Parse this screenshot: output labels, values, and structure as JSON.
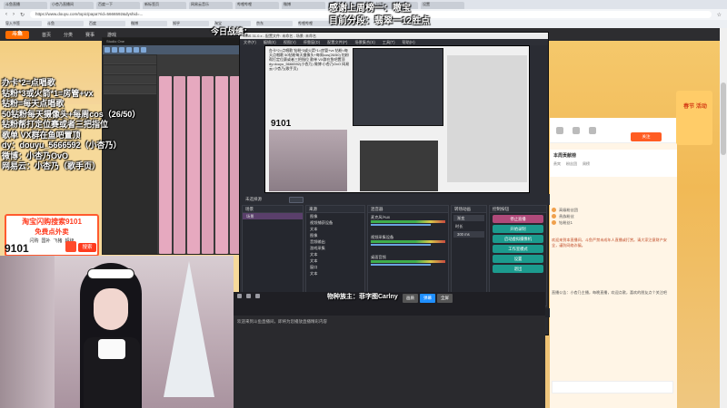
{
  "overlay": {
    "top_line1": "感谢上周榜一：嗷宝",
    "top_line2": "目前分段：翡翠一12胜点",
    "today_record": "今日战绩：",
    "lines": [
      "办卡*2=点唱歌",
      "钻粉*3或火箭*1=房管+vx",
      "钻粉=每天点唱歌",
      "50钻粉每天摄像头+每周cos（26/50）",
      "钻粉帮打定位赛或者三把指位",
      "歌单 VX群在鱼吧置顶",
      "dy：douyu_5666592（小杏乃）",
      "微博：小杏乃OvO",
      "网易云：小杏乃（歌手页）"
    ]
  },
  "promo": {
    "line1": "淘宝闪购搜索9101",
    "line2": "免费点外卖",
    "tags": [
      "闪购",
      "国补",
      "飞猪",
      "超级"
    ],
    "number": "9101",
    "search_label": "搜索"
  },
  "obs": {
    "menu": [
      "文件(F)",
      "编辑(E)",
      "视图(V)",
      "停靠窗(D)",
      "配置文件(P)",
      "场景集合(S)",
      "工具(T)",
      "帮助(H)"
    ],
    "preview_number": "9101",
    "preview_text": "办卡*2=点唱歌 钻粉*3或火箭*1=房管+vx 钻粉=每天点唱歌 50钻粉每天摄像头+每周cos(26/50) 钻粉帮打定位赛或者三把指位 歌单 VX群在鱼吧置顶 dy:douyu_5666592(小杏乃) 微博:小杏乃OvO 网易云:小杏乃(歌手页)",
    "no_source": "未选择源",
    "scenes_title": "场景",
    "scenes": [
      "场景"
    ],
    "sources_title": "来源",
    "sources": [
      "图像",
      "视频捕获设备",
      "文本",
      "图像",
      "音频输出",
      "游戏采集",
      "文本",
      "文本",
      "窗口",
      "文本"
    ],
    "mixer_title": "混音器",
    "mixer": [
      {
        "name": "麦克风/Aux",
        "db": "0.0 dB"
      },
      {
        "name": "视频采集设备",
        "db": "0.0 dB"
      },
      {
        "name": "桌面音频",
        "db": "0.0 dB"
      }
    ],
    "transitions_title": "转场动画",
    "transition_value": "渐变",
    "duration_label": "时长",
    "duration_value": "300 ms",
    "controls_title": "控制按钮",
    "controls": [
      "停止直播",
      "开始录制",
      "启动虚拟摄像机",
      "工作室模式",
      "设置",
      "退出"
    ],
    "status": [
      "00:00:00",
      "LIVE: 00:00:00",
      "REC: 00:00:00",
      "CPU: 1.3%, 60.00 fps",
      "延迟 (丢帧: 0 / 0.0%)"
    ]
  },
  "page": {
    "notice": "欢迎来到斗鱼直播间，即将为您播放直播精彩内容",
    "mini_tag": "物种族主：菲字图Carlny",
    "mini_btn1": "画质",
    "mini_btn2": "弹幕",
    "mini_btn3": "全屏",
    "follow": "关注",
    "rank_title": "本周贡献榜",
    "rank_tabs": [
      "贵宾",
      "粉丝团",
      "周榜"
    ],
    "chat_items": [
      "高级粉丝团",
      "贵族粉丝",
      "钻粉丝1"
    ],
    "chat_note": "欢迎来到本直播间，斗鱼严禁未成年人直播或打赏。请大家注意财产安全，谨防网络诈骗。",
    "chat_note2": "直播公告：小杏乃主播，每晚直播，欢迎点歌，喜欢的朋友点个关注吧",
    "card_text": "春节 活动",
    "nav": [
      "首页",
      "分类",
      "赛事",
      "游戏"
    ]
  },
  "browser": {
    "url": "https://www.douyu.com/topic/papa?rid=5666592&dyshid=...",
    "tabs": [
      "斗鱼直播",
      "小杏乃直播间",
      "百度一下",
      "新标签页",
      "网易云音乐",
      "哔哩哔哩",
      "微博",
      "淘宝",
      "抖音",
      "设置"
    ],
    "bookmarks": [
      "导入书签",
      "斗鱼",
      "百度",
      "微博",
      "知乎",
      "淘宝",
      "京东",
      "哔哩哔哩"
    ]
  }
}
